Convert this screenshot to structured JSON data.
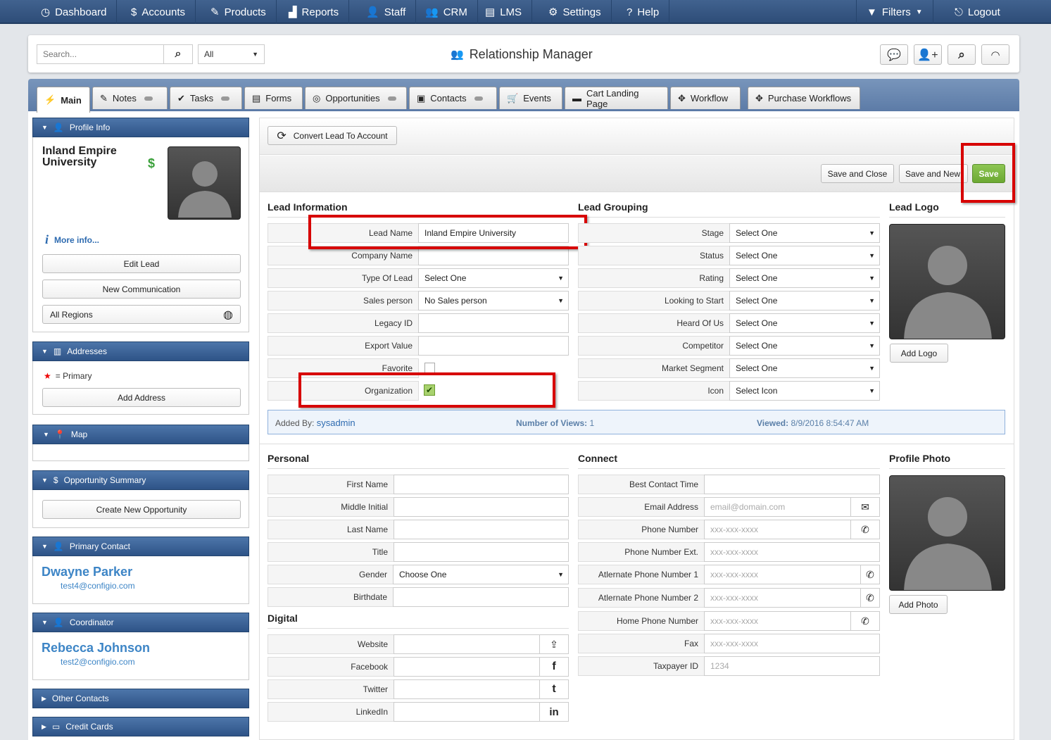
{
  "nav": {
    "items": [
      "Dashboard",
      "Accounts",
      "Products",
      "Reports",
      "Staff",
      "CRM",
      "LMS",
      "Settings",
      "Help"
    ],
    "filters": "Filters",
    "logout": "Logout"
  },
  "header": {
    "search_placeholder": "Search...",
    "scope": "All",
    "title": "Relationship Manager"
  },
  "tabs": [
    "Main",
    "Notes",
    "Tasks",
    "Forms",
    "Opportunities",
    "Contacts",
    "Events",
    "Cart Landing Page",
    "Workflow",
    "Purchase Workflows"
  ],
  "left": {
    "profile_header": "Profile Info",
    "name": "Inland Empire University",
    "currency_symbol": "$",
    "more_info": "More info...",
    "edit_lead": "Edit Lead",
    "new_communication": "New Communication",
    "regions": "All Regions",
    "addresses_header": "Addresses",
    "primary_star": "★",
    "primary_legend": "= Primary",
    "add_address": "Add Address",
    "map_header": "Map",
    "opportunity_header": "Opportunity Summary",
    "create_opportunity": "Create New Opportunity",
    "primary_contact_header": "Primary Contact",
    "primary_contact_name": "Dwayne Parker",
    "primary_contact_email": "test4@configio.com",
    "coordinator_header": "Coordinator",
    "coordinator_name": "Rebecca Johnson",
    "coordinator_email": "test2@configio.com",
    "other_contacts": "Other Contacts",
    "credit_cards": "Credit Cards"
  },
  "main": {
    "convert": "Convert Lead To Account",
    "save_close": "Save and Close",
    "save_new": "Save and New",
    "save": "Save",
    "lead_info_header": "Lead Information",
    "lead_grouping_header": "Lead Grouping",
    "lead_logo_header": "Lead Logo",
    "lead_fields": [
      {
        "label": "Lead Name",
        "value": "Inland Empire University"
      },
      {
        "label": "Company Name",
        "value": ""
      },
      {
        "label": "Type Of Lead",
        "value": "Select One"
      },
      {
        "label": "Sales person",
        "value": "No Sales person"
      },
      {
        "label": "Legacy ID",
        "value": ""
      },
      {
        "label": "Export Value",
        "value": ""
      },
      {
        "label": "Favorite",
        "value": ""
      },
      {
        "label": "Organization",
        "value": "✔"
      }
    ],
    "grouping_fields": [
      {
        "label": "Stage",
        "value": "Select One"
      },
      {
        "label": "Status",
        "value": "Select One"
      },
      {
        "label": "Rating",
        "value": "Select One"
      },
      {
        "label": "Looking to Start",
        "value": "Select One"
      },
      {
        "label": "Heard Of Us",
        "value": "Select One"
      },
      {
        "label": "Competitor",
        "value": "Select One"
      },
      {
        "label": "Market Segment",
        "value": "Select One"
      },
      {
        "label": "Icon",
        "value": "Select Icon"
      }
    ],
    "organization_checked": true,
    "favorite_checked": false,
    "add_logo": "Add Logo",
    "added_by_label": "Added By:",
    "added_by": "sysadmin",
    "views_label": "Number of Views:",
    "views": "1",
    "viewed_label": "Viewed:",
    "viewed": "8/9/2016 8:54:47 AM",
    "personal_header": "Personal",
    "connect_header": "Connect",
    "profile_photo_header": "Profile Photo",
    "digital_header": "Digital",
    "personal_fields": [
      {
        "label": "First Name",
        "value": ""
      },
      {
        "label": "Middle Initial",
        "value": ""
      },
      {
        "label": "Last Name",
        "value": ""
      },
      {
        "label": "Title",
        "value": ""
      },
      {
        "label": "Gender",
        "value": "Choose One"
      },
      {
        "label": "Birthdate",
        "value": ""
      }
    ],
    "digital_fields": [
      {
        "label": "Website",
        "icon": "⇪"
      },
      {
        "label": "Facebook",
        "icon": "f"
      },
      {
        "label": "Twitter",
        "icon": "t"
      },
      {
        "label": "LinkedIn",
        "icon": "in"
      }
    ],
    "connect_fields": [
      {
        "label": "Best Contact Time",
        "placeholder": ""
      },
      {
        "label": "Email Address",
        "placeholder": "email@domain.com"
      },
      {
        "label": "Phone Number",
        "placeholder": "xxx-xxx-xxxx"
      },
      {
        "label": "Phone Number Ext.",
        "placeholder": "xxx-xxx-xxxx"
      },
      {
        "label": "Atlernate Phone Number 1",
        "placeholder": "xxx-xxx-xxxx"
      },
      {
        "label": "Atlernate Phone Number 2",
        "placeholder": "xxx-xxx-xxxx"
      },
      {
        "label": "Home Phone Number",
        "placeholder": "xxx-xxx-xxxx"
      },
      {
        "label": "Fax",
        "placeholder": "xxx-xxx-xxxx"
      },
      {
        "label": "Taxpayer ID",
        "placeholder": "1234"
      }
    ],
    "add_photo": "Add Photo"
  },
  "colors": {
    "nav": "#2e4d78",
    "accent": "#4a7fc1",
    "save": "#7cb83c",
    "highlight": "#d70000"
  }
}
